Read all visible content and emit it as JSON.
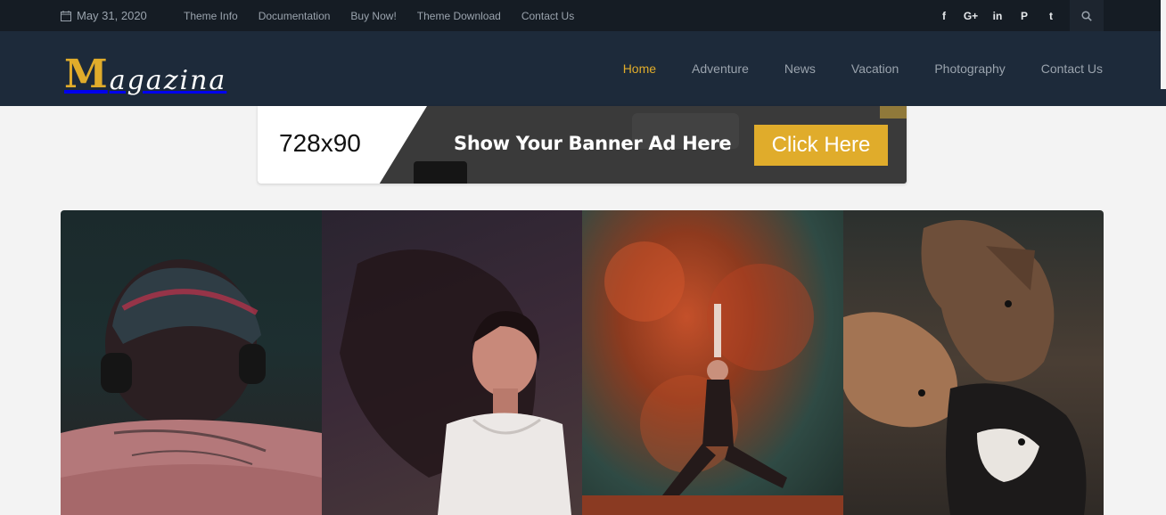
{
  "topbar": {
    "date": "May 31, 2020",
    "links": [
      "Theme Info",
      "Documentation",
      "Buy Now!",
      "Theme Download",
      "Contact Us"
    ],
    "social_icons": [
      "facebook-icon",
      "google-plus-icon",
      "linkedin-icon",
      "pinterest-icon",
      "twitter-icon"
    ],
    "social_glyphs": [
      "f",
      "G+",
      "in",
      "P",
      "t"
    ],
    "search_icon": "search-icon"
  },
  "header": {
    "logo_initial": "M",
    "logo_rest": "agazina",
    "nav": [
      "Home",
      "Adventure",
      "News",
      "Vacation",
      "Photography",
      "Contact Us"
    ],
    "active": "Home"
  },
  "banner": {
    "size": "728x90",
    "message": "Show Your Banner Ad Here",
    "cta": "Click Here"
  },
  "colors": {
    "accent": "#e0ac2b",
    "topbar_bg": "#151c24",
    "header_bg": "#1d2a3a",
    "page_bg": "#f3f3f3"
  }
}
